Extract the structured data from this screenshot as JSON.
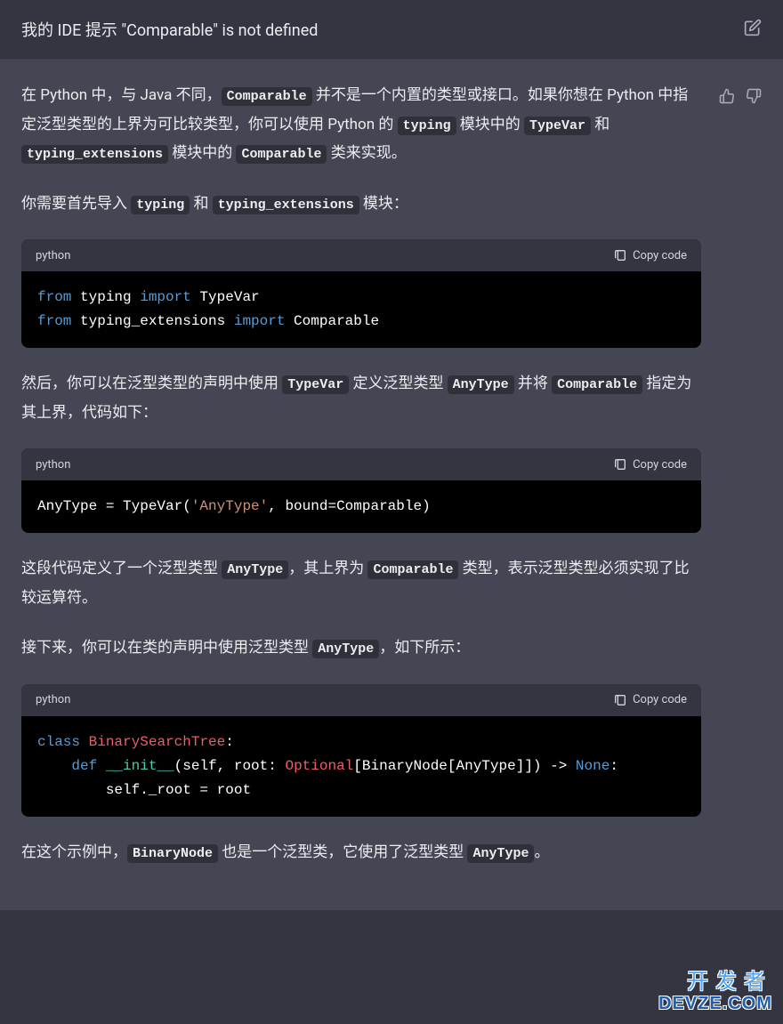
{
  "header": {
    "title": "我的 IDE 提示 \"Comparable\" is not defined"
  },
  "paragraphs": {
    "p1_1": "在 Python 中，与 Java 不同，",
    "p1_c1": "Comparable",
    "p1_2": " 并不是一个内置的类型或接口。如果你想在 Python 中指定泛型类型的上界为可比较类型，你可以使用 Python 的 ",
    "p1_c2": "typing",
    "p1_3": " 模块中的 ",
    "p1_c3": "TypeVar",
    "p1_4": " 和 ",
    "p1_c4": "typing_extensions",
    "p1_5": " 模块中的 ",
    "p1_c5": "Comparable",
    "p1_6": " 类来实现。",
    "p2_1": "你需要首先导入 ",
    "p2_c1": "typing",
    "p2_2": " 和 ",
    "p2_c2": "typing_extensions",
    "p2_3": " 模块：",
    "p3_1": "然后，你可以在泛型类型的声明中使用 ",
    "p3_c1": "TypeVar",
    "p3_2": " 定义泛型类型 ",
    "p3_c2": "AnyType",
    "p3_3": " 并将 ",
    "p3_c3": "Comparable",
    "p3_4": " 指定为其上界，代码如下：",
    "p4_1": "这段代码定义了一个泛型类型 ",
    "p4_c1": "AnyType",
    "p4_2": "，其上界为 ",
    "p4_c2": "Comparable",
    "p4_3": " 类型，表示泛型类型必须实现了比较运算符。",
    "p5_1": "接下来，你可以在类的声明中使用泛型类型 ",
    "p5_c1": "AnyType",
    "p5_2": "，如下所示：",
    "p6_1": "在这个示例中，",
    "p6_c1": "BinaryNode",
    "p6_2": " 也是一个泛型类，它使用了泛型类型 ",
    "p6_c2": "AnyType",
    "p6_3": "。"
  },
  "code_blocks": {
    "block1": {
      "lang": "python",
      "copy_label": "Copy code",
      "lines": {
        "l1_from": "from",
        "l1_mod": " typing ",
        "l1_import": "import",
        "l1_name": " TypeVar",
        "l2_from": "from",
        "l2_mod": " typing_extensions ",
        "l2_import": "import",
        "l2_name": " Comparable"
      }
    },
    "block2": {
      "lang": "python",
      "copy_label": "Copy code",
      "lines": {
        "l1_left": "AnyType = TypeVar(",
        "l1_str": "'AnyType'",
        "l1_right": ", bound=Comparable)"
      }
    },
    "block3": {
      "lang": "python",
      "copy_label": "Copy code",
      "lines": {
        "l1_class": "class",
        "l1_sp": " ",
        "l1_name": "BinarySearchTree",
        "l1_colon": ":",
        "l2_indent": "    ",
        "l2_def": "def",
        "l2_sp": " ",
        "l2_fn": "__init__",
        "l2_args1": "(self, root: ",
        "l2_opt": "Optional",
        "l2_args2": "[BinaryNode[AnyType]]) -> ",
        "l2_none": "None",
        "l2_colon": ":",
        "l3_indent": "        ",
        "l3_body": "self._root = root"
      }
    }
  },
  "watermark": {
    "top": "开发者",
    "bottom": "DEVZE.COM"
  }
}
